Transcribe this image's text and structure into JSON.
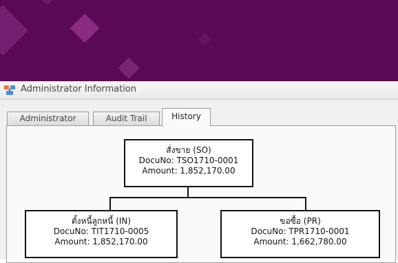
{
  "window": {
    "title": "Administrator Information",
    "icon": "window-app-icon"
  },
  "tabs": [
    {
      "label": "Administrator",
      "active": false
    },
    {
      "label": "Audit Trail",
      "active": false
    },
    {
      "label": "History",
      "active": true
    }
  ],
  "history": {
    "root": {
      "title": "สั่งขาย (SO)",
      "docuno": "DocuNo: TSO1710-0001",
      "amount": "Amount: 1,852,170.00"
    },
    "children": [
      {
        "title": "ตั้งหนี้ลูกหนี้ (IN)",
        "docuno": "DocuNo: TIT1710-0005",
        "amount": "Amount: 1,852,170.00"
      },
      {
        "title": "ขอซื้อ (PR)",
        "docuno": "DocuNo: TPR1710-0001",
        "amount": "Amount: 1,662,780.00"
      }
    ]
  },
  "colors": {
    "banner": "#5a0a55",
    "banner_accent": "#8a2a80",
    "node_border": "#111111",
    "panel_bg": "#fafafa"
  }
}
